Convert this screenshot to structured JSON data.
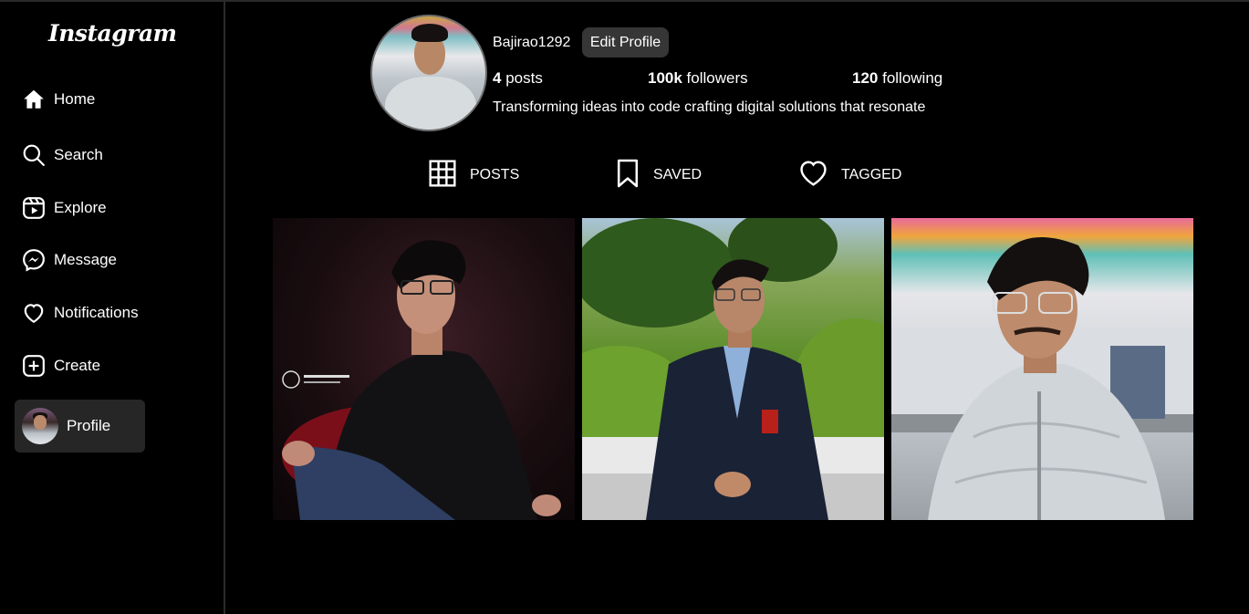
{
  "app": {
    "logo": "Instagram"
  },
  "sidebar": {
    "items": [
      {
        "label": "Home",
        "icon": "home-icon"
      },
      {
        "label": "Search",
        "icon": "search-icon"
      },
      {
        "label": "Explore",
        "icon": "reels-icon"
      },
      {
        "label": "Message",
        "icon": "messenger-icon"
      },
      {
        "label": "Notifications",
        "icon": "heart-icon"
      },
      {
        "label": "Create",
        "icon": "plus-square-icon"
      },
      {
        "label": "Profile",
        "icon": "avatar"
      }
    ]
  },
  "profile": {
    "username": "Bajirao1292",
    "edit_label": "Edit Profile",
    "posts_count": "4",
    "posts_label": " posts",
    "followers_count": "100k",
    "followers_label": " followers",
    "following_count": "120",
    "following_label": " following",
    "bio": "Transforming ideas into code crafting digital solutions that resonate"
  },
  "tabs": [
    {
      "label": "POSTS",
      "icon": "grid-icon"
    },
    {
      "label": "SAVED",
      "icon": "bookmark-icon"
    },
    {
      "label": "TAGGED",
      "icon": "heart-icon"
    }
  ],
  "posts": [
    {
      "alt": "photo-1"
    },
    {
      "alt": "photo-2"
    },
    {
      "alt": "photo-3"
    }
  ],
  "colors": {
    "background": "#000000",
    "active_nav": "#262626",
    "button": "#363636"
  }
}
